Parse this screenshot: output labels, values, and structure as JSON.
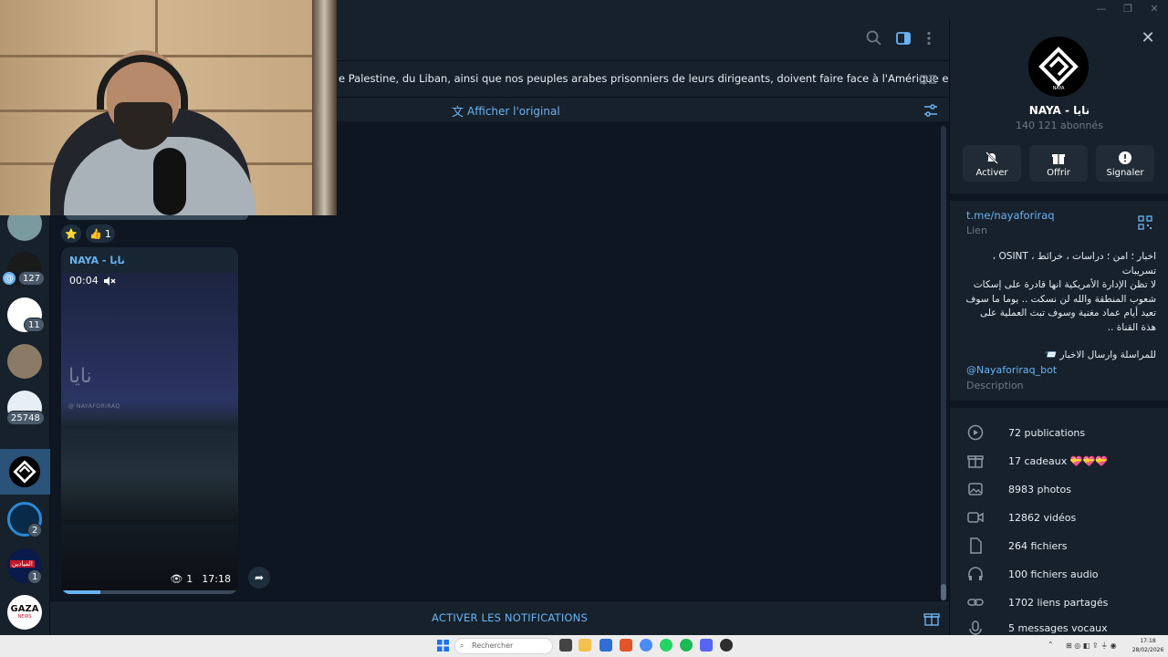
{
  "window": {
    "minimize": "—",
    "maximize": "❐",
    "close": "✕"
  },
  "chat_list": {
    "badges": [
      "127",
      "11",
      "25748",
      "2",
      "1"
    ],
    "mentions": "@",
    "avatar_labels": {
      "gaza": "GAZA",
      "gaza_sub": "NEWS",
      "red": "الميادين"
    }
  },
  "header": {
    "search_icon": "search-icon",
    "sidebar_icon": "sidebar-toggle-icon",
    "more_icon": "more-vertical-icon"
  },
  "pinned": {
    "text": "e Palestine, du Liban, ainsi que nos peuples arabes prisonniers de leurs dirigeants, doivent faire face à l'Amérique et à l'entité s...",
    "translate_label": "Afficher l'original"
  },
  "reactions": [
    {
      "emoji": "⭐",
      "count": ""
    },
    {
      "emoji": "👍",
      "count": "1"
    }
  ],
  "message": {
    "author": "NAYA - نايا",
    "duration": "00:04",
    "views": "1",
    "time": "17:18",
    "watermark": "نايا",
    "watermark_sub": "@ NAYAFORIRAQ",
    "progress": 0.22
  },
  "bottom_bar": {
    "notify_label": "ACTIVER LES NOTIFICATIONS"
  },
  "channel": {
    "name": "NAYA - نايا",
    "subscribers": "140 121 abonnés",
    "logo_text": "NAYA",
    "actions": [
      {
        "label": "Activer",
        "icon": "bell-off-icon"
      },
      {
        "label": "Offrir",
        "icon": "gift-icon"
      },
      {
        "label": "Signaler",
        "icon": "report-icon"
      }
    ],
    "link": "t.me/nayaforiraq",
    "link_label": "Lien",
    "desc_line1": "اخبار ؛ امن ؛ دراسات ، خرائط ، OSINT ، تسريبات",
    "desc_para": "لا تظن الإدارة الأمريكية انها قادرة على إسكات شعوب المنطقة والله لن نسكت .. يوما ما سوف تعيد أيام عماد مغنية وسوف تبث العملية على هذة القناة ..",
    "desc_contact": "للمراسلة وارسال الاخبار 📨",
    "desc_bot": "@Nayaforiraq_bot",
    "desc_label": "Description",
    "stats": [
      {
        "icon": "publications-icon",
        "label": "72 publications"
      },
      {
        "icon": "gift-icon",
        "label": "17 cadeaux 💝💝💝"
      },
      {
        "icon": "photo-icon",
        "label": "8983 photos"
      },
      {
        "icon": "video-icon",
        "label": "12862 vidéos"
      },
      {
        "icon": "file-icon",
        "label": "264 fichiers"
      },
      {
        "icon": "headphones-icon",
        "label": "100 fichiers audio"
      },
      {
        "icon": "link-icon",
        "label": "1702 liens partagés"
      },
      {
        "icon": "mic-icon",
        "label": "5 messages vocaux"
      }
    ]
  },
  "taskbar": {
    "search_placeholder": "Rechercher",
    "clock_time": "17:18",
    "clock_date": "28/02/2026"
  },
  "colors": {
    "accent": "#6ab3f3",
    "bg": "#0e1621",
    "panel": "#17212b",
    "active": "#2b5278"
  }
}
